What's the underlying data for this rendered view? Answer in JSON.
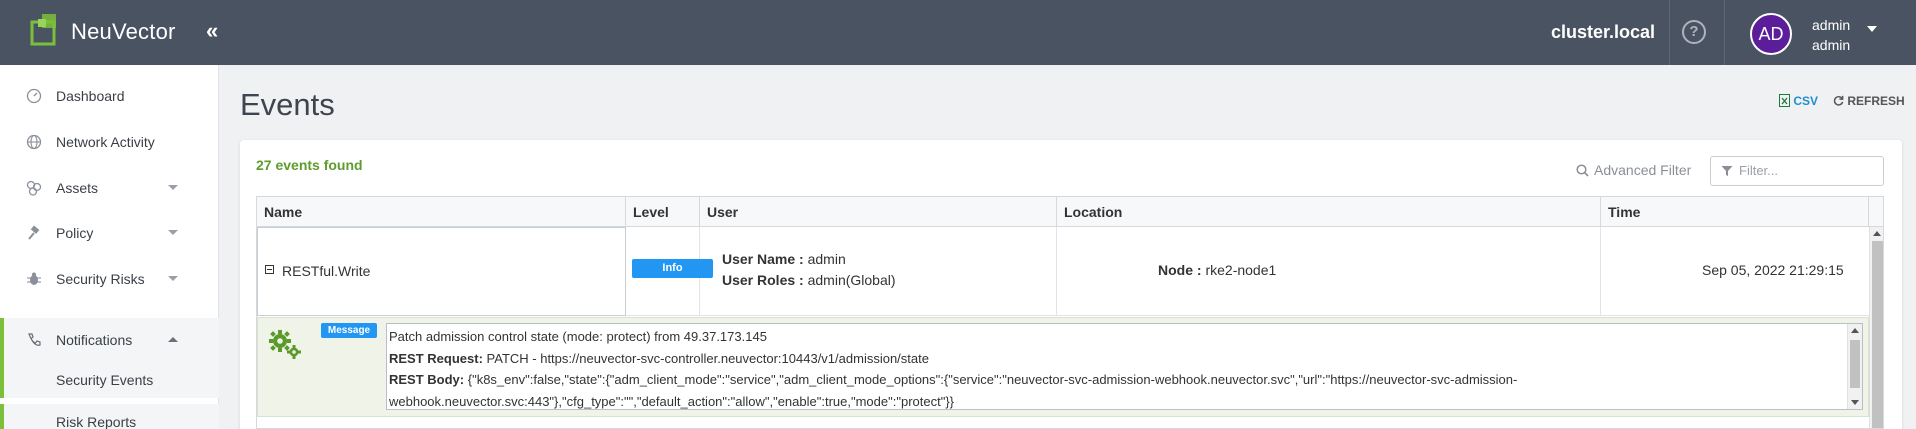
{
  "header": {
    "brand": "NeuVector",
    "cluster": "cluster.local",
    "avatar_initials": "AD",
    "user_name": "admin",
    "user_role": "admin"
  },
  "sidebar": {
    "items": [
      {
        "label": "Dashboard",
        "icon": "dashboard-icon"
      },
      {
        "label": "Network Activity",
        "icon": "globe-icon"
      },
      {
        "label": "Assets",
        "icon": "assets-icon"
      },
      {
        "label": "Policy",
        "icon": "policy-icon"
      },
      {
        "label": "Security Risks",
        "icon": "bug-icon"
      },
      {
        "label": "Notifications",
        "icon": "phone-icon"
      }
    ],
    "sub_items": [
      "Security Events",
      "Risk Reports"
    ]
  },
  "page": {
    "title": "Events",
    "csv_label": "CSV",
    "refresh_label": "REFRESH",
    "found": "27 events found",
    "advanced_filter": "Advanced Filter",
    "filter_placeholder": "Filter..."
  },
  "table": {
    "columns": [
      "Name",
      "Level",
      "User",
      "Location",
      "Time"
    ],
    "rows": [
      {
        "name": "RESTful.Write",
        "level": "Info",
        "user_name_label": "User Name :",
        "user_name": "admin",
        "user_roles_label": "User Roles :",
        "user_roles": "admin(Global)",
        "node_label": "Node :",
        "node": "rke2-node1",
        "time": "Sep 05, 2022 21:29:15"
      }
    ],
    "detail": {
      "badge": "Message",
      "message": "Patch admission control state (mode: protect) from 49.37.173.145",
      "request_label": "REST Request:",
      "request": "PATCH - https://neuvector-svc-controller.neuvector:10443/v1/admission/state",
      "body_label": "REST Body:",
      "body": "{\"k8s_env\":false,\"state\":{\"adm_client_mode\":\"service\",\"adm_client_mode_options\":{\"service\":\"neuvector-svc-admission-webhook.neuvector.svc\",\"url\":\"https://neuvector-svc-admission-webhook.neuvector.svc:443\"},\"cfg_type\":\"\",\"default_action\":\"allow\",\"enable\":true,\"mode\":\"protect\"}}"
    }
  },
  "colors": {
    "topbar": "#4a5361",
    "accent_green": "#7bbf3a",
    "info_blue": "#2196f3",
    "avatar": "#5b1d9a"
  }
}
